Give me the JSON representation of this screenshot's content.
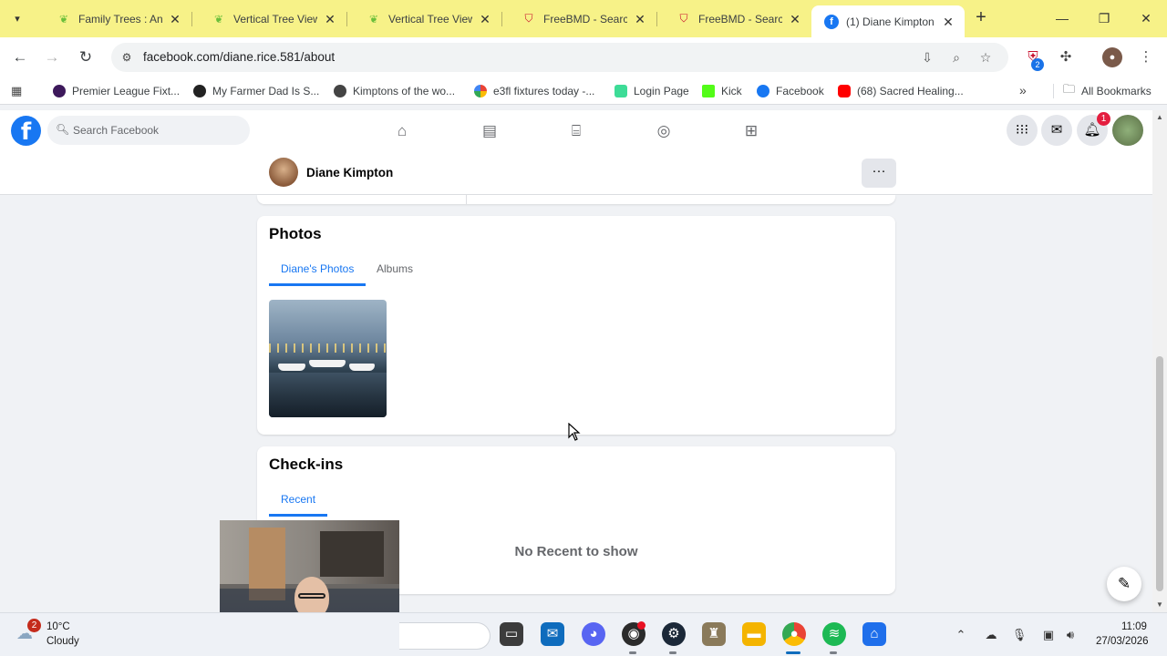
{
  "browser": {
    "tabs": [
      {
        "title": "Family Trees : Ance",
        "icon": "ancestry-leaf-icon",
        "color": "#6bbf3b"
      },
      {
        "title": "Vertical Tree View",
        "icon": "ancestry-leaf-icon",
        "color": "#6bbf3b"
      },
      {
        "title": "Vertical Tree View",
        "icon": "ancestry-leaf-icon",
        "color": "#6bbf3b"
      },
      {
        "title": "FreeBMD - Search",
        "icon": "freebmd-icon",
        "color": "#c8102e"
      },
      {
        "title": "FreeBMD - Search",
        "icon": "freebmd-icon",
        "color": "#c8102e"
      },
      {
        "title": "(1) Diane Kimpton",
        "icon": "facebook-icon",
        "color": "#1877f2",
        "active": true
      }
    ],
    "tab_close": "✕",
    "new_tab": "+",
    "url": "facebook.com/diane.rice.581/about",
    "extension_badge": "2",
    "bookmarks": [
      {
        "label": "Premier League Fixt...",
        "color": "#3d195b"
      },
      {
        "label": "My Farmer Dad Is S...",
        "color": "#222222"
      },
      {
        "label": "Kimptons of the wo...",
        "color": "#333333"
      },
      {
        "label": "e3fl fixtures today -...",
        "color": "#4285f4"
      },
      {
        "label": "Login Page",
        "color": "#3ddc97"
      },
      {
        "label": "Kick",
        "color": "#53fc18"
      },
      {
        "label": "Facebook",
        "color": "#1877f2"
      },
      {
        "label": "(68) Sacred Healing...",
        "color": "#ff0000"
      }
    ],
    "all_bookmarks": "All Bookmarks"
  },
  "facebook": {
    "logo": "f",
    "search_placeholder": "Search Facebook",
    "notification_count": "1",
    "profile_name": "Diane Kimpton",
    "more_label": "···",
    "photos": {
      "title": "Photos",
      "tabs": [
        "Diane's Photos",
        "Albums"
      ]
    },
    "checkins": {
      "title": "Check-ins",
      "tabs": [
        "Recent"
      ],
      "empty_message": "No Recent to show"
    }
  },
  "taskbar": {
    "weather_badge": "2",
    "temperature": "10°C",
    "condition": "Cloudy",
    "time": "11:09",
    "date": "27/03/2026"
  },
  "colors": {
    "tabbar_bg": "#f7f288",
    "fb_blue": "#1877f2",
    "fb_bg": "#f0f2f5"
  }
}
